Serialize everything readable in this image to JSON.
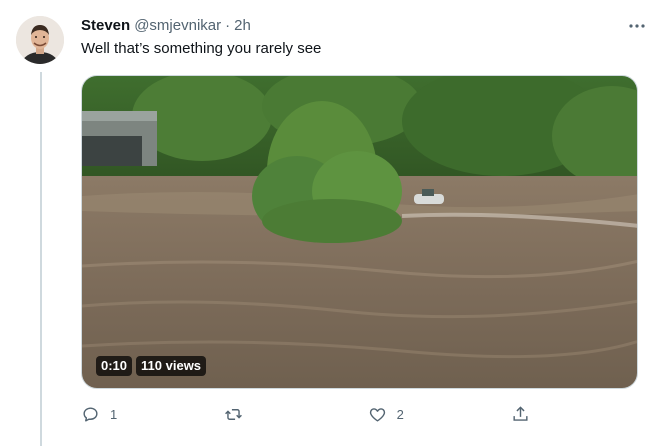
{
  "tweet": {
    "author_name": "Steven",
    "author_handle": "@smjevnikar",
    "separator": "·",
    "time": "2h",
    "text": "Well that’s something you rarely see",
    "avatar_icon": "user-avatar"
  },
  "media": {
    "duration": "0:10",
    "views": "110 views",
    "description_icon": "video-thumbnail"
  },
  "actions": {
    "reply_count": "1",
    "retweet_count": "",
    "like_count": "2",
    "share_count": ""
  },
  "colors": {
    "text_primary": "#0f1419",
    "text_secondary": "#536471",
    "border": "#cfd9de"
  }
}
